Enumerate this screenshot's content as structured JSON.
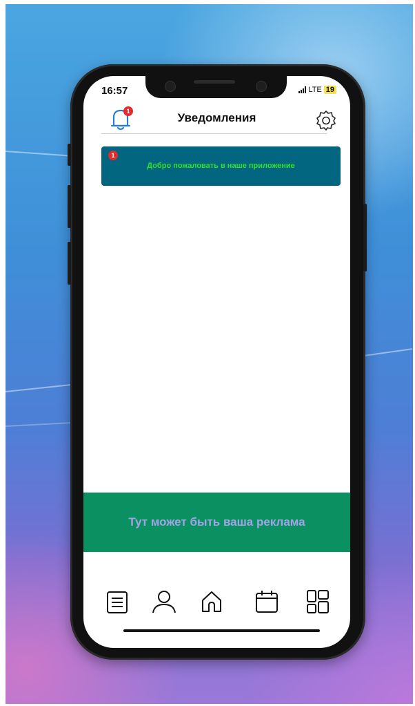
{
  "status_bar": {
    "time": "16:57",
    "network": "LTE",
    "battery": "19"
  },
  "header": {
    "title": "Уведомления",
    "bell_badge": "1",
    "bell_icon": "bell-icon",
    "settings_icon": "gear-icon"
  },
  "notifications": [
    {
      "badge": "1",
      "text": "Добро пожаловать в наше приложение"
    }
  ],
  "ad": {
    "text": "Тут может быть ваша реклама"
  },
  "bottom_nav": [
    {
      "icon": "list-icon"
    },
    {
      "icon": "profile-icon"
    },
    {
      "icon": "home-icon"
    },
    {
      "icon": "calendar-icon"
    },
    {
      "icon": "dashboard-icon"
    }
  ],
  "colors": {
    "notification_bg": "#036680",
    "notification_text": "#2fe02a",
    "ad_bg": "#0a9061",
    "ad_text": "#a3a3e8",
    "badge": "#e22b2b"
  }
}
